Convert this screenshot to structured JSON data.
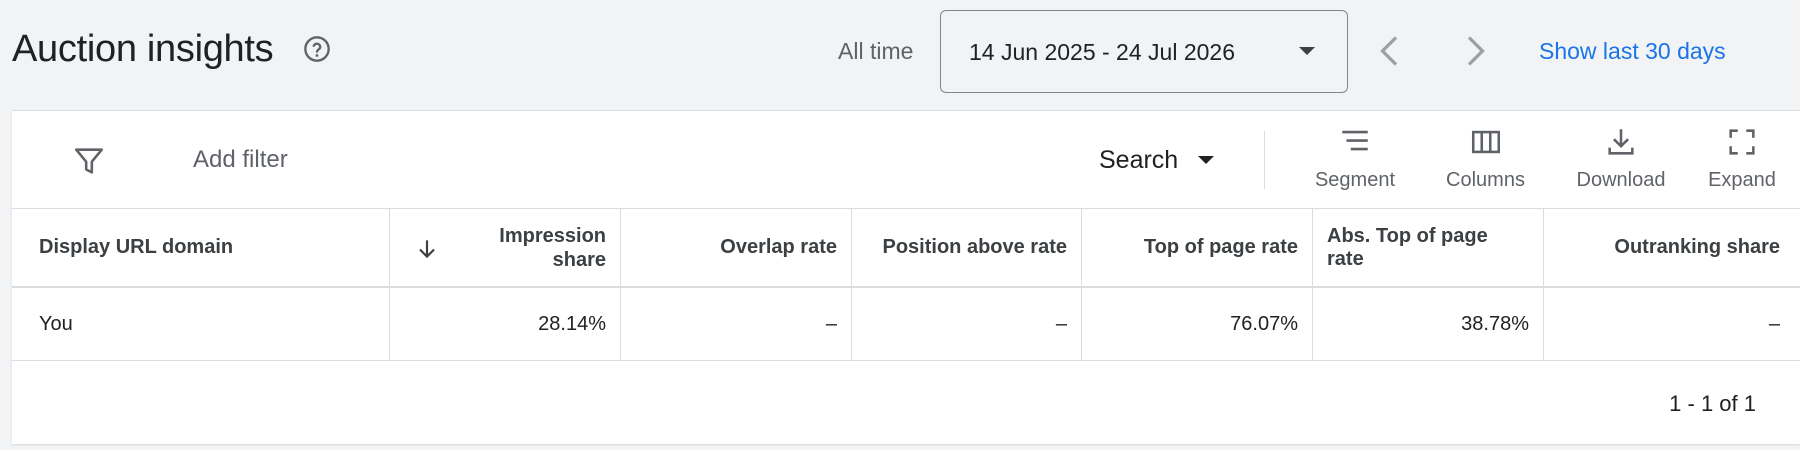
{
  "header": {
    "title": "Auction insights",
    "range_label": "All time",
    "date_range": "14 Jun 2025 - 24 Jul 2026",
    "show_last": "Show last 30 days"
  },
  "toolbar": {
    "add_filter": "Add filter",
    "search_label": "Search",
    "buttons": [
      {
        "label": "Segment",
        "icon": "segment-icon"
      },
      {
        "label": "Columns",
        "icon": "columns-icon"
      },
      {
        "label": "Download",
        "icon": "download-icon"
      },
      {
        "label": "Expand",
        "icon": "expand-icon"
      }
    ]
  },
  "table": {
    "columns": [
      "Display URL domain",
      "Impression share",
      "Overlap rate",
      "Position above rate",
      "Top of page rate",
      "Abs. Top of page rate",
      "Outranking share"
    ],
    "sorted_column": "Impression share",
    "sort_direction": "descending",
    "rows": [
      [
        "You",
        "28.14%",
        "–",
        "–",
        "76.07%",
        "38.78%",
        "–"
      ]
    ]
  },
  "pagination": "1 - 1 of 1",
  "colors": {
    "link": "#1a73e8",
    "background": "#f1f3f4",
    "card": "#ffffff",
    "divider": "#dadce0"
  }
}
